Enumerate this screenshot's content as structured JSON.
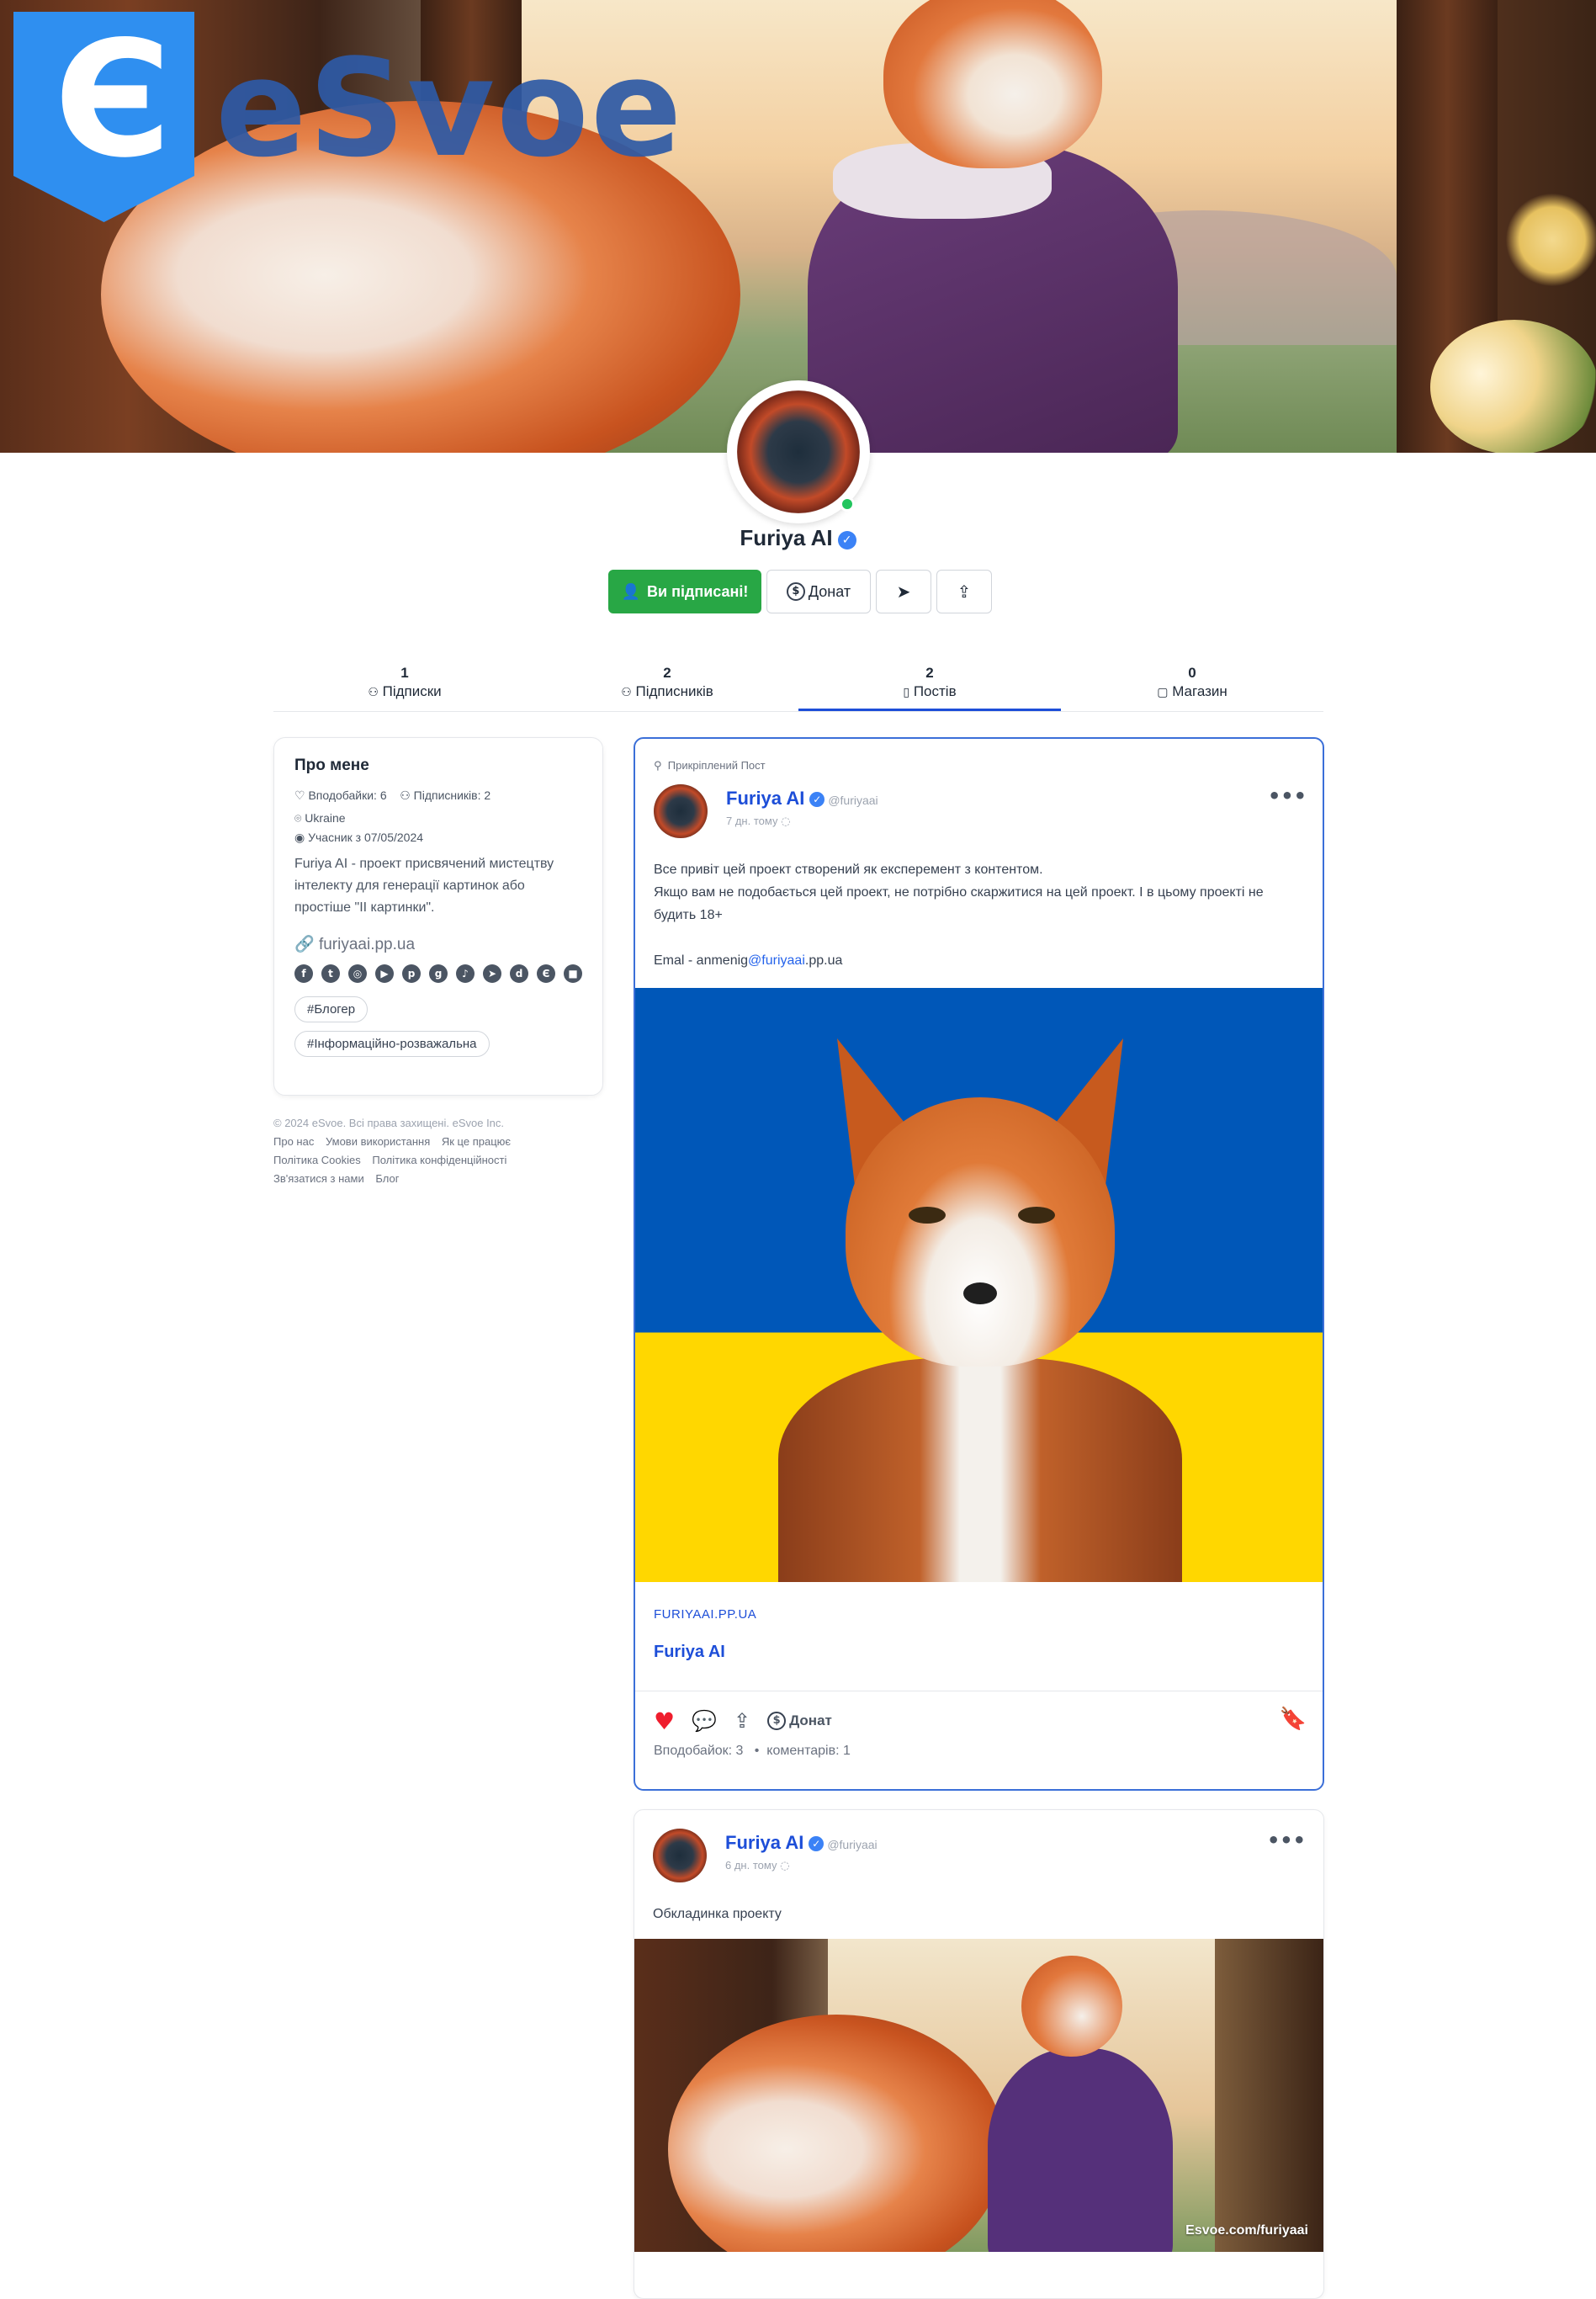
{
  "brand": {
    "logo_letter": "Є",
    "logo_word": "eSvoe"
  },
  "profile": {
    "name": "Furiya AI",
    "verified_glyph": "✓",
    "status": "online"
  },
  "actions": {
    "subscribed_label": "Ви підписані!",
    "donate_label": "Донат",
    "send_icon": "send-icon",
    "share_icon": "share-icon"
  },
  "tabs": [
    {
      "count": "1",
      "label": "Підписки",
      "icon": "user-check-icon"
    },
    {
      "count": "2",
      "label": "Підписників",
      "icon": "users-icon"
    },
    {
      "count": "2",
      "label": "Постів",
      "icon": "document-icon",
      "active": true
    },
    {
      "count": "0",
      "label": "Магазин",
      "icon": "shopping-bag-icon"
    }
  ],
  "about": {
    "title": "Про мене",
    "likes": "Вподобайки: 6",
    "followers": "Підписників: 2",
    "location": "Ukraine",
    "member_since": "Учасник з 07/05/2024",
    "bio": "Furiya AI - проект присвячений мистецтву інтелекту для генерації картинок або простіше \"ІІ картинки\".",
    "link": "furiyaai.pp.ua",
    "socials": [
      "facebook-icon",
      "twitter-icon",
      "instagram-icon",
      "youtube-icon",
      "pinterest-icon",
      "github-icon",
      "tiktok-icon",
      "telegram-icon",
      "discord-icon",
      "esvoe-icon",
      "video-icon"
    ],
    "tags": [
      "#Блогер",
      "#Інформаційно-розважальна"
    ]
  },
  "footer": {
    "copyright": "© 2024 eSvoe. Всі права захищені. eSvoe Inc.",
    "links_row1": [
      "Про нас",
      "Умови використання",
      "Як це працює"
    ],
    "links_row2": [
      "Політика Cookies",
      "Політика конфіденційності"
    ],
    "links_row3": [
      "Зв'язатися з нами",
      "Блог"
    ]
  },
  "posts": [
    {
      "pinned_label": "Прикріплений Пост",
      "author": "Furiya AI",
      "handle": "@furiyaai",
      "time": "7 дн. тому",
      "text_line1": "Все привіт цей проект створений як експеремент з контентом.",
      "text_line2": "Якщо вам не подобається цей проект, не потрібно скаржитися на цей проект. І в цьому проекті не будить 18+",
      "email_prefix": "Emal - anmenig",
      "email_link": "@furiyaai",
      "email_suffix": ".pp.ua",
      "link_domain": "FURIYAAI.PP.UA",
      "link_title": "Furiya AI",
      "donate_label": "Донат",
      "likes": "Вподобайок: 3",
      "comments": "коментарів: 1"
    },
    {
      "author": "Furiya AI",
      "handle": "@furiyaai",
      "time": "6 дн. тому",
      "text": "Обкладинка проекту",
      "watermark": "Esvoe.com/furiyaai"
    }
  ],
  "colors": {
    "accent": "#1d4ed8",
    "subscribe": "#28a745",
    "like": "#ef1d2d",
    "online": "#22c55e"
  }
}
